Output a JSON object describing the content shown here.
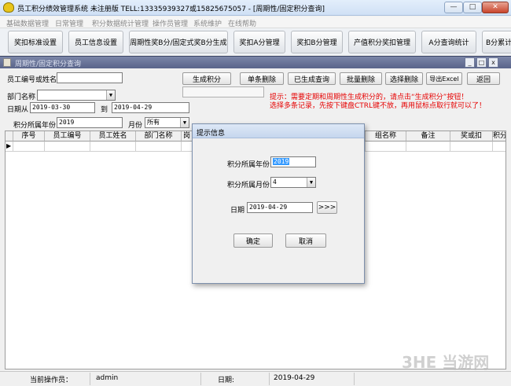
{
  "window": {
    "title": "员工积分绩效管理系统 未注册版 TELL:13335939327或15825675057 - [周期性/固定积分查询]",
    "min": "—",
    "max": "□",
    "close": "✕"
  },
  "menu": [
    "基础数据管理",
    "日常管理",
    "积分数据统计管理",
    "操作员管理",
    "系统维护",
    "在线帮助"
  ],
  "toolbar": [
    "奖扣标准设置",
    "员工信息设置",
    "周期性奖B分/固定式奖B分生成",
    "奖扣A分管理",
    "奖扣B分管理",
    "产值积分奖扣管理",
    "A分查询统计",
    "B分累计"
  ],
  "subwindow": {
    "title": "周期性/固定积分查询",
    "ctrl_min": "_",
    "ctrl_max": "□",
    "ctrl_close": "x"
  },
  "form": {
    "employee_label": "员工编号或姓名",
    "employee_value": "",
    "dept_label": "部门名称",
    "dept_value": "",
    "date_from_label": "日期从",
    "date_from": "2019-03-30",
    "date_to_label": "到",
    "date_to": "2019-04-29",
    "year_label": "积分所属年份",
    "year": "2019",
    "month_label": "月份",
    "month": "所有"
  },
  "buttons": {
    "generate": "生成积分",
    "delete_single": "单条删除",
    "query_generated": "已生成查询",
    "batch_delete": "批量删除",
    "select_delete": "选择删除",
    "export_excel": "导出Excel",
    "back": "返回"
  },
  "hints": [
    "提示：需要定期和周期性生成积分的，请点击“生成积分”按钮！",
    "选择多条记录，先按下键盘CTRL键不放，再用鼠标点取行就可以了！"
  ],
  "grid": {
    "columns": [
      "序号",
      "员工编号",
      "员工姓名",
      "部门名称",
      "岗",
      "",
      "",
      "",
      "",
      "组名称",
      "备注",
      "奖或扣",
      "积分"
    ],
    "row_marker": "▶"
  },
  "dialog": {
    "title": "提示信息",
    "year_label": "积分所属年份",
    "year": "2019",
    "month_label": "积分所属月份",
    "month": "4",
    "date_label": "日期",
    "date": "2019-04-29",
    "picker": ">>>",
    "ok": "确定",
    "cancel": "取消"
  },
  "status": {
    "operator_label": "当前操作员：",
    "operator": "admin",
    "date_label": "日期:",
    "date": "2019-04-29"
  },
  "watermark": "3HE 当游网"
}
